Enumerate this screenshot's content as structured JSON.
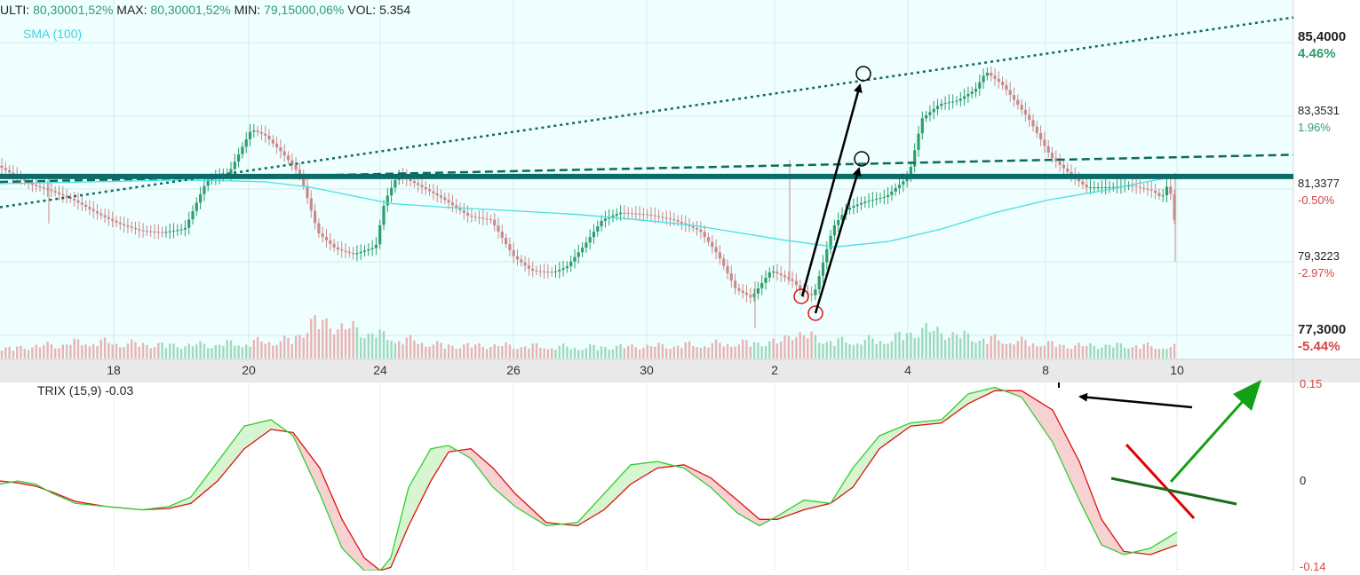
{
  "header": {
    "ulti_label": "ULTI:",
    "ulti_value": "80,30001,52%",
    "max_label": "MAX:",
    "max_value": "80,30001,52%",
    "min_label": "MIN:",
    "min_value": "79,15000,06%",
    "vol_label": "VOL:",
    "vol_value": "5.354"
  },
  "indicators": {
    "sma_label": "SMA (100)",
    "trix_label": "TRIX (15,9) -0.03"
  },
  "colors": {
    "price_bg": "#effefe",
    "up_candle": "#2e9e6d",
    "down_candle": "#c98a8a",
    "sma": "#49dfe6",
    "support_line": "#0b6b67",
    "trend_line": "#0e6b5a",
    "trix_main": "#33cc33",
    "trix_signal": "#dd1111",
    "pct_up": "#2e9e6d",
    "pct_down": "#d04848"
  },
  "chart_data": [
    {
      "type": "candlestick",
      "x_tick_labels": [
        "18",
        "20",
        "24",
        "26",
        "30",
        "2",
        "4",
        "8",
        "10"
      ],
      "price_axis": [
        {
          "price": "85,4000",
          "pct": "4.46%",
          "dir": "up"
        },
        {
          "price": "83,3531",
          "pct": "1.96%",
          "dir": "up"
        },
        {
          "price": "81,3377",
          "pct": "-0.50%",
          "dir": "down"
        },
        {
          "price": "79,3223",
          "pct": "-2.97%",
          "dir": "down"
        },
        {
          "price": "77,3000",
          "pct": "-5.44%",
          "dir": "down"
        }
      ],
      "ylim": [
        77.3,
        85.4
      ],
      "path_x": [
        0,
        20,
        40,
        60,
        85,
        110,
        135,
        160,
        185,
        210,
        235,
        260,
        285,
        300,
        320,
        340,
        360,
        380,
        400,
        425,
        435,
        450,
        470,
        500,
        530,
        555,
        580,
        600,
        625,
        640,
        660,
        680,
        700,
        730,
        760,
        790,
        810,
        830,
        848,
        870,
        895,
        905,
        918,
        940,
        955,
        975,
        1000,
        1025,
        1040,
        1060,
        1080,
        1100,
        1112,
        1130,
        1160,
        1185,
        1205,
        1225,
        1250,
        1275,
        1300,
        1310,
        1318,
        1324
      ],
      "path_y": [
        81.8,
        81.5,
        81.25,
        81.1,
        80.85,
        80.5,
        80.2,
        80.0,
        79.95,
        80.05,
        81.4,
        81.6,
        82.8,
        82.65,
        82.15,
        81.55,
        79.95,
        79.5,
        79.35,
        79.55,
        80.8,
        81.55,
        81.3,
        80.9,
        80.4,
        80.3,
        79.3,
        78.9,
        78.85,
        79.0,
        79.6,
        80.3,
        80.5,
        80.45,
        80.3,
        80.0,
        79.35,
        78.4,
        78.15,
        78.9,
        78.6,
        78.3,
        78.2,
        80.1,
        80.6,
        80.8,
        80.95,
        81.5,
        83.1,
        83.5,
        83.6,
        83.9,
        84.4,
        84.05,
        83.1,
        82.05,
        81.6,
        81.2,
        81.2,
        81.25,
        81.1,
        80.9,
        81.35,
        80.3
      ],
      "sma100_x": [
        0,
        100,
        200,
        260,
        300,
        350,
        400,
        440,
        500,
        580,
        650,
        720,
        780,
        830,
        880,
        940,
        1000,
        1060,
        1120,
        1180,
        1240,
        1290,
        1324
      ],
      "sma100_y": [
        81.3,
        81.35,
        81.4,
        81.38,
        81.35,
        81.2,
        80.95,
        80.75,
        80.65,
        80.55,
        80.45,
        80.3,
        80.15,
        79.95,
        79.75,
        79.55,
        79.7,
        80.05,
        80.5,
        80.85,
        81.1,
        81.35,
        81.5
      ],
      "support_level": 81.5,
      "trendline_upper": {
        "x": [
          0,
          1456
        ],
        "y": [
          80.65,
          85.9
        ]
      },
      "trendline_dashed": {
        "x": [
          0,
          1456
        ],
        "y": [
          81.35,
          82.1
        ]
      },
      "volume_x": [
        0,
        100,
        200,
        260,
        330,
        352,
        420,
        430,
        500,
        560,
        650,
        760,
        880,
        890,
        940,
        1000,
        1040,
        1050,
        1100,
        1200,
        1280,
        1324
      ],
      "volume_v": [
        0.25,
        0.45,
        0.35,
        0.4,
        0.5,
        1.0,
        0.7,
        0.6,
        0.35,
        0.35,
        0.3,
        0.35,
        0.45,
        0.7,
        0.45,
        0.5,
        0.8,
        0.75,
        0.55,
        0.35,
        0.35,
        0.3
      ]
    },
    {
      "type": "line",
      "title": "TRIX (15,9) -0.03",
      "y_tick_labels": [
        "0.15",
        "0",
        "-0.14"
      ],
      "ylim": [
        -0.14,
        0.15
      ],
      "series": [
        {
          "role": "trix",
          "x": [
            0,
            20,
            40,
            60,
            85,
            120,
            160,
            190,
            215,
            245,
            275,
            305,
            330,
            360,
            385,
            410,
            428,
            440,
            460,
            485,
            505,
            530,
            555,
            580,
            615,
            650,
            680,
            710,
            740,
            770,
            800,
            830,
            855,
            875,
            905,
            935,
            960,
            990,
            1025,
            1060,
            1090,
            1120,
            1150,
            1185,
            1215,
            1240,
            1265,
            1295,
            1325
          ],
          "y": [
            -0.005,
            0.0,
            -0.005,
            -0.02,
            -0.035,
            -0.04,
            -0.045,
            -0.04,
            -0.025,
            0.03,
            0.085,
            0.095,
            0.07,
            -0.02,
            -0.105,
            -0.14,
            -0.14,
            -0.12,
            -0.01,
            0.05,
            0.055,
            0.035,
            -0.01,
            -0.04,
            -0.07,
            -0.065,
            -0.02,
            0.025,
            0.03,
            0.02,
            -0.01,
            -0.05,
            -0.07,
            -0.055,
            -0.03,
            -0.035,
            0.02,
            0.07,
            0.09,
            0.095,
            0.135,
            0.145,
            0.13,
            0.06,
            -0.03,
            -0.1,
            -0.115,
            -0.105,
            -0.08
          ]
        },
        {
          "role": "signal",
          "x": [
            0,
            20,
            40,
            60,
            85,
            120,
            160,
            190,
            215,
            245,
            275,
            305,
            330,
            360,
            385,
            410,
            428,
            440,
            460,
            485,
            505,
            530,
            555,
            580,
            615,
            650,
            680,
            710,
            740,
            770,
            800,
            830,
            855,
            875,
            905,
            935,
            960,
            990,
            1025,
            1060,
            1090,
            1120,
            1150,
            1185,
            1215,
            1240,
            1265,
            1295,
            1325
          ],
          "y": [
            0.0,
            -0.003,
            -0.008,
            -0.018,
            -0.032,
            -0.04,
            -0.045,
            -0.043,
            -0.035,
            0.0,
            0.05,
            0.08,
            0.075,
            0.02,
            -0.06,
            -0.12,
            -0.14,
            -0.135,
            -0.07,
            0.0,
            0.045,
            0.05,
            0.02,
            -0.02,
            -0.065,
            -0.07,
            -0.045,
            -0.005,
            0.02,
            0.025,
            0.005,
            -0.03,
            -0.06,
            -0.06,
            -0.045,
            -0.035,
            -0.01,
            0.05,
            0.085,
            0.09,
            0.12,
            0.14,
            0.14,
            0.11,
            0.03,
            -0.06,
            -0.11,
            -0.115,
            -0.1
          ]
        }
      ]
    }
  ]
}
